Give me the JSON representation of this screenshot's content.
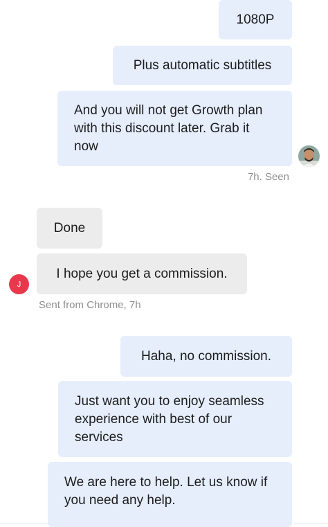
{
  "messages": {
    "m1": "1080P",
    "m2": "Plus automatic subtitles",
    "m3": "And you will not get Growth plan with this discount later. Grab it now",
    "seen": "7h. Seen",
    "m4": "Done",
    "m5": "I hope you get a commission.",
    "sent_from": "Sent from Chrome, 7h",
    "m6": "Haha, no commission.",
    "m7": "Just want you to enjoy seamless experience with best of our services",
    "m8": "We are here to help. Let us know if you need any help."
  },
  "contact": {
    "initial": "J"
  },
  "colors": {
    "outgoing_bubble": "#e6eefc",
    "incoming_bubble": "#ececec",
    "avatar_badge": "#e8394c",
    "meta_text": "#8e8e93"
  }
}
